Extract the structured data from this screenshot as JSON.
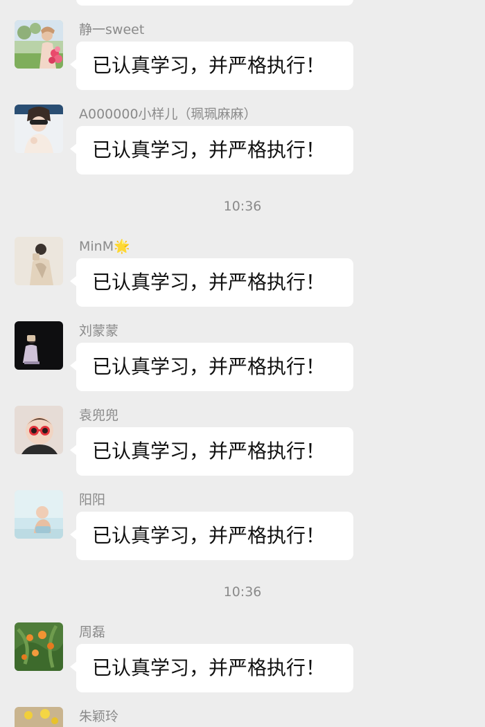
{
  "chat": {
    "messages": [
      {
        "sender": "静一sweet",
        "text": "已认真学习，并严格执行！",
        "avatar": "avatar-girl-flowers"
      },
      {
        "sender": "A000000小样儿（珮珮麻麻）",
        "text": "已认真学习，并严格执行！",
        "avatar": "avatar-girl-sunglasses"
      },
      {
        "sender": "MinM🌟",
        "text": "已认真学习，并严格执行！",
        "avatar": "avatar-person-light"
      },
      {
        "sender": "刘蒙蒙",
        "text": "已认真学习，并严格执行！",
        "avatar": "avatar-person-dark"
      },
      {
        "sender": "袁兜兜",
        "text": "已认真学习，并严格执行！",
        "avatar": "avatar-child-sunglasses"
      },
      {
        "sender": "阳阳",
        "text": "已认真学习，并严格执行！",
        "avatar": "avatar-baby"
      },
      {
        "sender": "周磊",
        "text": "已认真学习，并严格执行！",
        "avatar": "avatar-orange-flowers"
      },
      {
        "sender": "朱颖玲",
        "text": "",
        "avatar": "avatar-yellow-flowers"
      }
    ],
    "timestamps": [
      "10:36",
      "10:36"
    ]
  },
  "colors": {
    "background": "#ededed",
    "bubble": "#ffffff",
    "name_text": "#8a8a8a",
    "message_text": "#111111"
  }
}
